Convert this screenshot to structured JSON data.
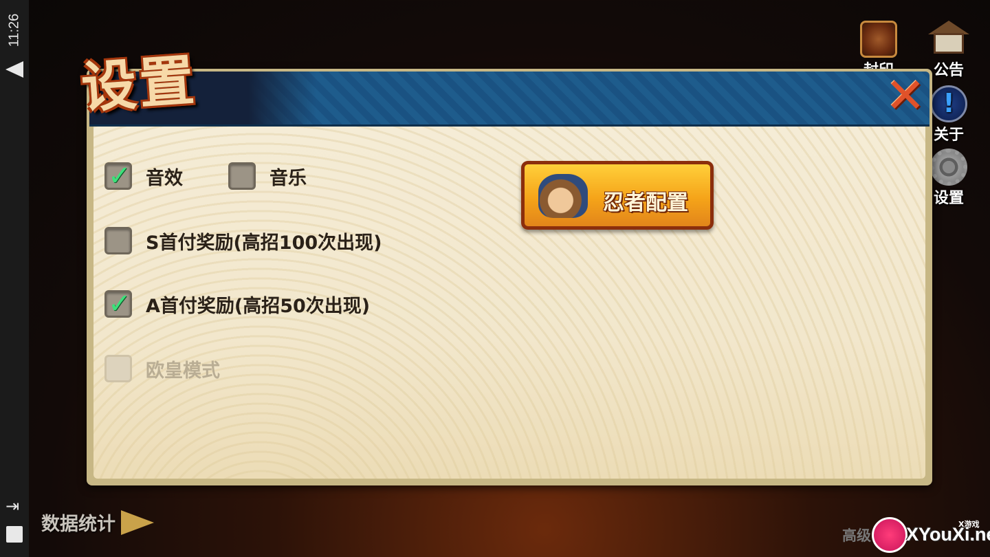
{
  "status_bar": {
    "time": "11:26",
    "icons": [
      "wifi-icon",
      "enter-icon",
      "battery-icon"
    ]
  },
  "side_menu": {
    "items": [
      {
        "label": "封印",
        "icon": "seal-icon"
      },
      {
        "label": "公告",
        "icon": "notice-board-icon"
      },
      {
        "label": "关于",
        "icon": "info-icon"
      },
      {
        "label": "设置",
        "icon": "gear-icon"
      }
    ]
  },
  "dialog": {
    "title": "设置",
    "close_icon": "close-icon",
    "options": [
      {
        "label": "音效",
        "checked": true,
        "disabled": false
      },
      {
        "label": "音乐",
        "checked": false,
        "disabled": false
      },
      {
        "label": "S首付奖励(高招100次出现)",
        "checked": false,
        "disabled": false
      },
      {
        "label": "A首付奖励(高招50次出现)",
        "checked": true,
        "disabled": false
      },
      {
        "label": "欧皇模式",
        "checked": false,
        "disabled": true
      }
    ],
    "ninja_config_button": {
      "label": "忍者配置",
      "icon": "ninja-avatar-icon"
    }
  },
  "footer": {
    "stats_label": "数据统计",
    "stats_icon": "arrow-right-icon",
    "advanced_label": "高级"
  },
  "watermark": {
    "small_text": "X游戏",
    "text": "XYouXi.net"
  },
  "colors": {
    "check": "#3de07a",
    "header_blue": "#1e5c8c",
    "button_orange": "#f5a419",
    "title_red": "#a5360c"
  }
}
